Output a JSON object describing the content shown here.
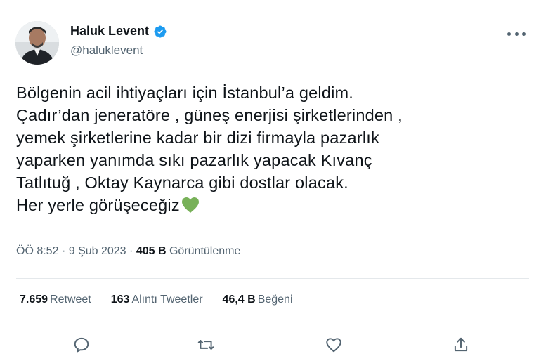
{
  "author": {
    "display_name": "Haluk Levent",
    "handle": "@haluklevent",
    "verified_color": "#1d9bf0"
  },
  "tweet": {
    "lines": [
      "Bölgenin acil ihtiyaçları için İstanbul’a geldim.",
      "Çadır’dan jeneratöre , güneş enerjisi şirketlerinden ,",
      "yemek şirketlerine kadar bir dizi firmayla pazarlık",
      "yaparken yanımda sıkı pazarlık yapacak Kıvanç",
      "Tatlıtuğ , Oktay Kaynarca gibi dostlar olacak.",
      "Her yerle görüşeceğiz"
    ],
    "emoji": "green-heart",
    "emoji_color": "#78b159"
  },
  "meta": {
    "time": "ÖÖ 8:52",
    "separator": "·",
    "date": "9 Şub 2023",
    "views_count": "405 B",
    "views_label": "Görüntülenme"
  },
  "stats": {
    "retweets": {
      "count": "7.659",
      "label": "Retweet"
    },
    "quotes": {
      "count": "163",
      "label": "Alıntı Tweetler"
    },
    "likes": {
      "count": "46,4 B",
      "label": "Beğeni"
    }
  },
  "actions": [
    "reply-icon",
    "retweet-icon",
    "like-icon",
    "share-icon"
  ],
  "colors": {
    "text": "#0f1419",
    "secondary": "#536471",
    "divider": "#e4e8eb"
  }
}
